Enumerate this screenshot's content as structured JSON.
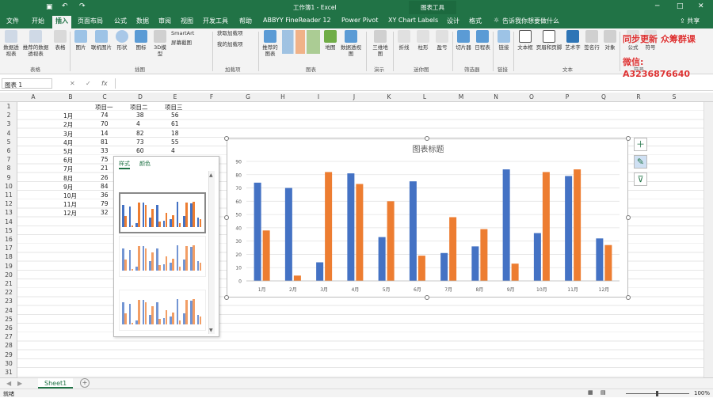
{
  "titlebar": {
    "doc_title": "工作簿1 - Excel",
    "context_tool": "图表工具"
  },
  "tabs": [
    "文件",
    "开始",
    "插入",
    "页面布局",
    "公式",
    "数据",
    "审阅",
    "视图",
    "开发工具",
    "帮助",
    "ABBYY FineReader 12",
    "Power Pivot",
    "XY Chart Labels",
    "设计",
    "格式"
  ],
  "active_tab": "插入",
  "tell_me": "告诉我你想要做什么",
  "share": "共享",
  "ribbon": {
    "buttons": [
      "数据透视表",
      "推荐的数据透视表",
      "表格",
      "图片",
      "联机图片",
      "形状",
      "图标",
      "3D模型",
      "SmartArt",
      "屏幕截图",
      "获取加载项",
      "我的加载项",
      "推荐的图表",
      "地图",
      "数据透视图",
      "三维地图",
      "折线",
      "柱形",
      "盈亏",
      "切片器",
      "日程表",
      "链接",
      "文本框",
      "页眉和页脚",
      "艺术字",
      "签名行",
      "对象",
      "公式",
      "符号"
    ],
    "groups": [
      "表格",
      "插图",
      "加载项",
      "图表",
      "演示",
      "迷你图",
      "筛选器",
      "链接",
      "文本",
      "符号"
    ]
  },
  "formula": {
    "namebox": "图表 1",
    "fx": "fx"
  },
  "columns": [
    "A",
    "B",
    "C",
    "D",
    "E",
    "F",
    "G",
    "H",
    "I",
    "J",
    "K",
    "L",
    "M",
    "N",
    "O",
    "P",
    "Q",
    "R",
    "S"
  ],
  "rows": [
    "1",
    "2",
    "3",
    "4",
    "5",
    "6",
    "7",
    "8",
    "9",
    "10",
    "11",
    "12",
    "13",
    "14",
    "15",
    "16",
    "17",
    "18",
    "19",
    "20",
    "21",
    "22",
    "23",
    "24",
    "25",
    "26",
    "27",
    "28",
    "29",
    "30",
    "31"
  ],
  "table": {
    "headers": [
      "项目一",
      "项目二",
      "项目三"
    ],
    "months": [
      "1月",
      "2月",
      "3月",
      "4月",
      "5月",
      "6月",
      "7月",
      "8月",
      "9月",
      "10月",
      "11月",
      "12月"
    ],
    "col1": [
      "74",
      "70",
      "14",
      "81",
      "33",
      "75",
      "21",
      "26",
      "84",
      "36",
      "79",
      "32"
    ],
    "col2": [
      "38",
      "4",
      "82",
      "73",
      "60"
    ],
    "col3": [
      "56",
      "61",
      "18",
      "55",
      "4"
    ]
  },
  "chart_data": {
    "type": "bar",
    "title": "图表标题",
    "categories": [
      "1月",
      "2月",
      "3月",
      "4月",
      "5月",
      "6月",
      "7月",
      "8月",
      "9月",
      "10月",
      "11月",
      "12月"
    ],
    "series": [
      {
        "name": "项目一",
        "color": "#4472c4",
        "values": [
          74,
          70,
          14,
          81,
          33,
          75,
          21,
          26,
          84,
          36,
          79,
          32
        ]
      },
      {
        "name": "项目二",
        "color": "#ed7d31",
        "values": [
          38,
          4,
          82,
          73,
          60,
          19,
          48,
          39,
          13,
          82,
          84,
          27
        ]
      }
    ],
    "ylim": [
      0,
      90
    ],
    "yticks": [
      "0",
      "10",
      "20",
      "30",
      "40",
      "50",
      "60",
      "70",
      "80",
      "90"
    ],
    "grid": true
  },
  "style_panel": {
    "tab_style": "样式",
    "tab_color": "颜色"
  },
  "sheet": {
    "name": "Sheet1",
    "add": "+"
  },
  "status": {
    "ready": "就绪",
    "zoom": "100%"
  },
  "watermark": {
    "line1": "同步更新 众筹群课",
    "line2": "微信: A3236876640"
  }
}
